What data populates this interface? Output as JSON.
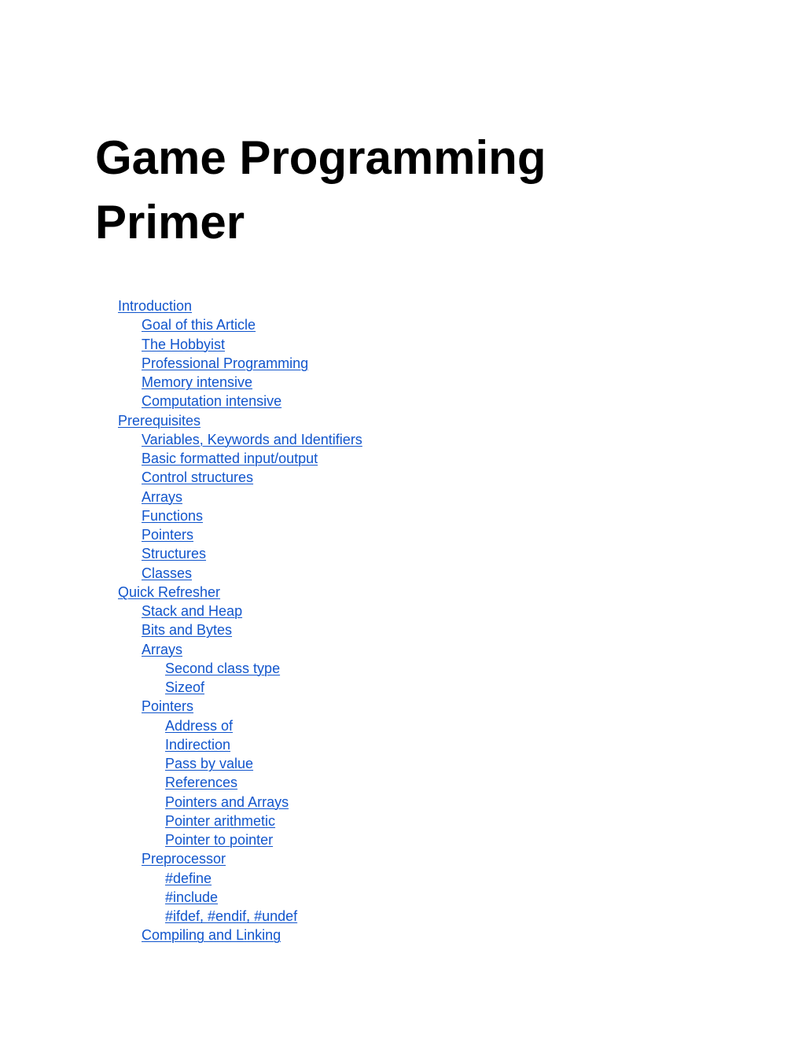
{
  "document": {
    "title": "Game Programming Primer",
    "link_color": "#1155cc",
    "toc": [
      {
        "label": "Introduction",
        "level": 1
      },
      {
        "label": "Goal of this Article",
        "level": 2
      },
      {
        "label": "The Hobbyist",
        "level": 2
      },
      {
        "label": "Professional Programming",
        "level": 2
      },
      {
        "label": "Memory intensive",
        "level": 2
      },
      {
        "label": "Computation intensive",
        "level": 2
      },
      {
        "label": "Prerequisites",
        "level": 1
      },
      {
        "label": "Variables, Keywords and Identifiers",
        "level": 2
      },
      {
        "label": "Basic formatted input/output",
        "level": 2
      },
      {
        "label": "Control structures",
        "level": 2
      },
      {
        "label": "Arrays",
        "level": 2
      },
      {
        "label": "Functions",
        "level": 2
      },
      {
        "label": "Pointers",
        "level": 2
      },
      {
        "label": "Structures",
        "level": 2
      },
      {
        "label": "Classes",
        "level": 2
      },
      {
        "label": "Quick Refresher",
        "level": 1
      },
      {
        "label": "Stack and Heap",
        "level": 2
      },
      {
        "label": "Bits and Bytes",
        "level": 2
      },
      {
        "label": "Arrays",
        "level": 2
      },
      {
        "label": "Second class type",
        "level": 3
      },
      {
        "label": "Sizeof",
        "level": 3
      },
      {
        "label": "Pointers",
        "level": 2
      },
      {
        "label": "Address of",
        "level": 3
      },
      {
        "label": "Indirection",
        "level": 3
      },
      {
        "label": "Pass by value",
        "level": 3
      },
      {
        "label": "References",
        "level": 3
      },
      {
        "label": "Pointers and Arrays",
        "level": 3
      },
      {
        "label": "Pointer arithmetic",
        "level": 3
      },
      {
        "label": "Pointer to pointer",
        "level": 3
      },
      {
        "label": "Preprocessor",
        "level": 2
      },
      {
        "label": "#define",
        "level": 3
      },
      {
        "label": "#include",
        "level": 3
      },
      {
        "label": "#ifdef, #endif, #undef",
        "level": 3
      },
      {
        "label": "Compiling and Linking",
        "level": 2
      }
    ]
  }
}
